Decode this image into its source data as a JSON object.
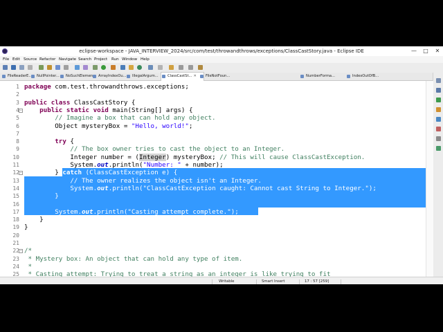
{
  "window": {
    "title": "eclipse-workspace - JAVA_INTERVIEW_2024/src/com/test/throwandthrows/exceptions/ClassCastStory.java - Eclipse IDE",
    "minimize": "—",
    "maximize": "□",
    "close": "✕"
  },
  "menu": [
    "File",
    "Edit",
    "Source",
    "Refactor",
    "Navigate",
    "Search",
    "Project",
    "Run",
    "Window",
    "Help"
  ],
  "tabs": [
    {
      "label": "FileReaderE...",
      "active": false
    },
    {
      "label": "NullPointer...",
      "active": false
    },
    {
      "label": "NoSuchElemen...",
      "active": false
    },
    {
      "label": "ArrayIndexOu...",
      "active": false
    },
    {
      "label": "IllegalArgum...",
      "active": false
    },
    {
      "label": "ClassCastSt...",
      "active": true
    },
    {
      "label": "FileNotFoun...",
      "active": false
    },
    {
      "label": "NumberForma...",
      "active": false
    },
    {
      "label": "IndexOutOfB...",
      "active": false
    }
  ],
  "tab_close": "✕",
  "code": {
    "lines": [
      {
        "n": "1",
        "segs": [
          [
            "kw",
            "package"
          ],
          [
            "",
            " com.test.throwandthrows.exceptions;"
          ]
        ]
      },
      {
        "n": "2",
        "segs": []
      },
      {
        "n": "3",
        "segs": [
          [
            "kw",
            "public"
          ],
          [
            "",
            " "
          ],
          [
            "kw",
            "class"
          ],
          [
            "",
            " ClassCastStory {"
          ]
        ]
      },
      {
        "n": "4",
        "segs": [
          [
            "",
            "    "
          ],
          [
            "kw",
            "public"
          ],
          [
            "",
            " "
          ],
          [
            "kw",
            "static"
          ],
          [
            "",
            " "
          ],
          [
            "kw",
            "void"
          ],
          [
            "",
            " main(String[] args) {"
          ]
        ]
      },
      {
        "n": "5",
        "segs": [
          [
            "",
            "        "
          ],
          [
            "cm",
            "// Imagine a box that can hold any object."
          ]
        ]
      },
      {
        "n": "6",
        "segs": [
          [
            "",
            "        Object mysteryBox = "
          ],
          [
            "st",
            "\"Hello, world!\""
          ],
          [
            "",
            ";"
          ]
        ]
      },
      {
        "n": "7",
        "segs": []
      },
      {
        "n": "8",
        "segs": [
          [
            "",
            "        "
          ],
          [
            "kw",
            "try"
          ],
          [
            "",
            " {"
          ]
        ]
      },
      {
        "n": "9",
        "segs": [
          [
            "",
            "            "
          ],
          [
            "cm",
            "// The box owner tries to cast the object to an Integer."
          ]
        ]
      },
      {
        "n": "10",
        "segs": [
          [
            "",
            "            Integer number = ("
          ],
          [
            "hl",
            "Integer"
          ],
          [
            "",
            ") mysteryBox; "
          ],
          [
            "cm",
            "// This will cause ClassCastException."
          ]
        ]
      },
      {
        "n": "11",
        "segs": [
          [
            "",
            "            System."
          ],
          [
            "fld",
            "out"
          ],
          [
            "",
            ".println("
          ],
          [
            "st",
            "\"Number: \""
          ],
          [
            "",
            " + number);"
          ]
        ]
      },
      {
        "n": "12",
        "segs": [
          [
            "",
            "        } "
          ],
          [
            "kw",
            "catch"
          ],
          [
            "",
            " (ClassCastException e) {"
          ]
        ]
      },
      {
        "n": "13",
        "segs": [
          [
            "",
            "            "
          ],
          [
            "cm",
            "// The owner realizes the object isn't an Integer."
          ]
        ]
      },
      {
        "n": "14",
        "segs": [
          [
            "",
            "            System."
          ],
          [
            "fld",
            "out"
          ],
          [
            "",
            ".println("
          ],
          [
            "st",
            "\"ClassCastException caught: Cannot cast String to Integer.\""
          ],
          [
            "",
            ");"
          ]
        ]
      },
      {
        "n": "15",
        "segs": [
          [
            "",
            "        }"
          ]
        ]
      },
      {
        "n": "16",
        "segs": []
      },
      {
        "n": "17",
        "segs": [
          [
            "",
            "        System."
          ],
          [
            "fld",
            "out"
          ],
          [
            "",
            ".println("
          ],
          [
            "st",
            "\"Casting attempt complete.\""
          ],
          [
            "",
            ");"
          ]
        ]
      },
      {
        "n": "18",
        "segs": [
          [
            "",
            "    }"
          ]
        ]
      },
      {
        "n": "19",
        "segs": [
          [
            "",
            "}"
          ]
        ]
      },
      {
        "n": "20",
        "segs": []
      },
      {
        "n": "21",
        "segs": []
      },
      {
        "n": "22",
        "segs": [
          [
            "cm",
            "/*"
          ]
        ]
      },
      {
        "n": "23",
        "segs": [
          [
            "cm",
            " * Mystery box: An object that can hold any type of item."
          ]
        ]
      },
      {
        "n": "24",
        "segs": [
          [
            "cm",
            " *"
          ]
        ]
      },
      {
        "n": "25",
        "segs": [
          [
            "cm",
            " * Casting attempt: Trying to treat a string as an integer is like trying to fit"
          ]
        ]
      }
    ]
  },
  "status": {
    "writable": "Writable",
    "insert_mode": "Smart Insert",
    "position": "17 : 57 [259]"
  },
  "colors": {
    "selection": "#3399ff",
    "keyword": "#7f0055",
    "comment": "#3f7f5f",
    "string": "#2a00ff"
  }
}
